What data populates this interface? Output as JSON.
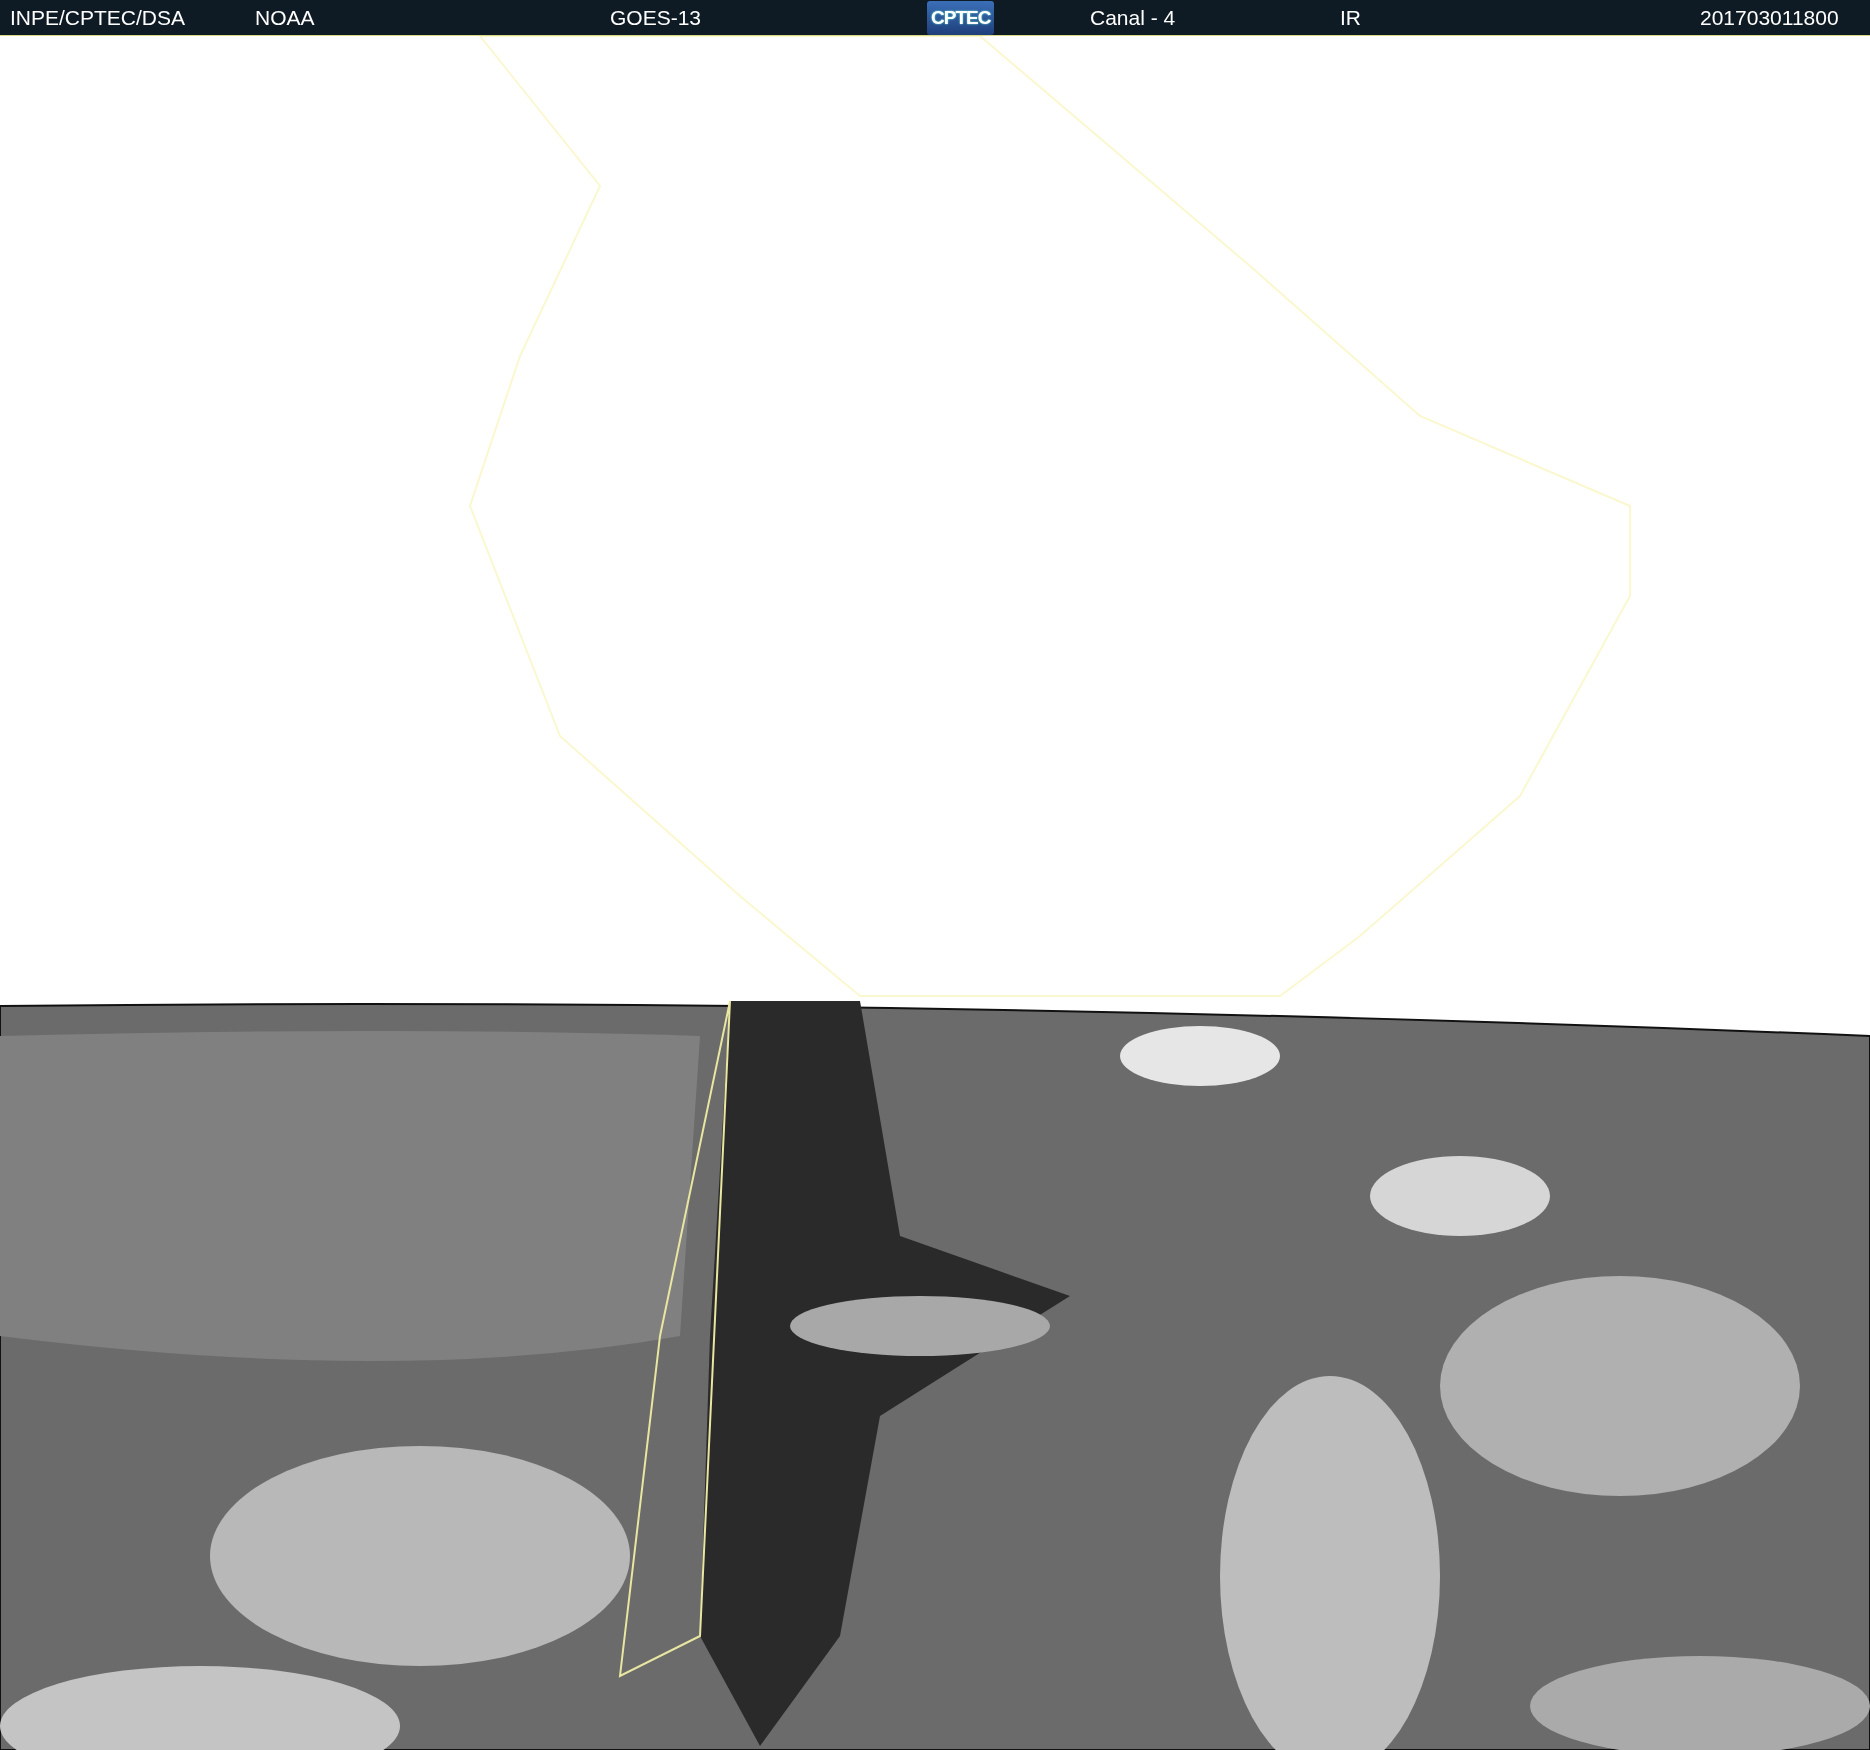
{
  "header": {
    "items": [
      {
        "kind": "text",
        "text": "INPE/CPTEC/DSA"
      },
      {
        "kind": "text",
        "text": "NOAA"
      },
      {
        "kind": "text",
        "text": "GOES-13"
      },
      {
        "kind": "logo",
        "text": "CPTEC"
      },
      {
        "kind": "text",
        "text": "Canal - 4"
      },
      {
        "kind": "text",
        "text": "IR"
      },
      {
        "kind": "text",
        "text": "201703011800"
      }
    ]
  }
}
